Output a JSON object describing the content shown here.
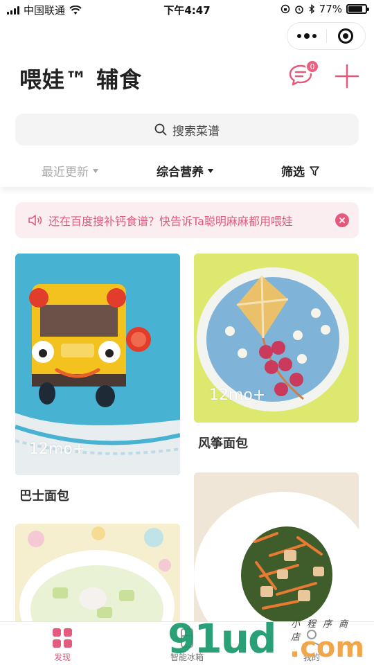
{
  "status_bar": {
    "carrier": "中国联通",
    "time": "下午4:47",
    "battery": "77%",
    "battery_level": 0.77
  },
  "header": {
    "title": "喂娃™ 辅食",
    "message_badge": "0",
    "icons": {
      "message": "chat-bubble-icon",
      "add": "plus-icon"
    }
  },
  "search": {
    "placeholder": "搜索菜谱"
  },
  "sort": {
    "recent": "最近更新",
    "nutrition": "综合营养",
    "filter": "筛选"
  },
  "notice": {
    "text": "还在百度搜补钙食谱？快告诉Ta聪明麻麻都用喂娃"
  },
  "recipes": [
    {
      "title": "巴士面包",
      "age": "12mo+"
    },
    {
      "title": "风筝面包",
      "age": "12mo+"
    }
  ],
  "tabbar": {
    "tabs": [
      {
        "label": "发现"
      },
      {
        "label": "智能冰箱"
      },
      {
        "label": "我的"
      }
    ]
  },
  "watermark": {
    "main": "91ud",
    "suffix": ".com",
    "cn": "小程序商店"
  },
  "colors": {
    "accent": "#e35a7c",
    "notice_bg": "#fbeef1"
  }
}
